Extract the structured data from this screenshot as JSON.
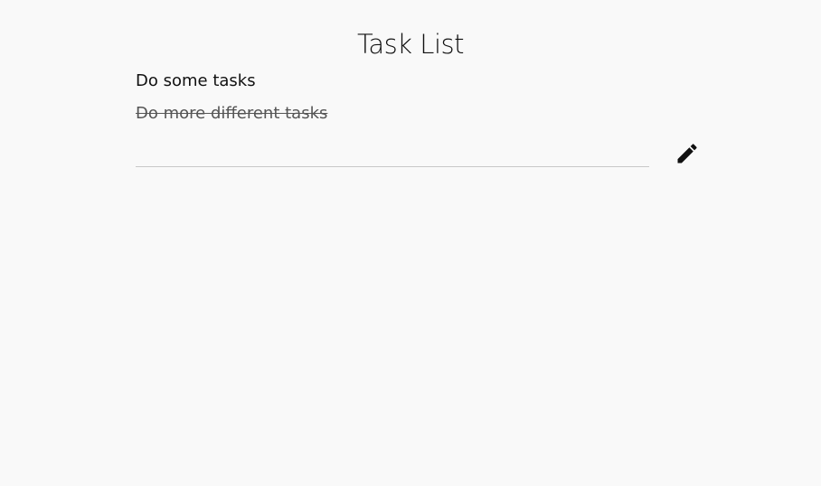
{
  "page": {
    "title": "Task List"
  },
  "tasks": [
    {
      "label": "Do some tasks",
      "done": false
    },
    {
      "label": "Do more different tasks",
      "done": true
    }
  ],
  "new_task": {
    "value": "",
    "placeholder": ""
  },
  "edit_button": {
    "icon": "pencil-icon"
  },
  "colors": {
    "background": "#f9f9f9",
    "text": "#111111",
    "completed_text": "#555555",
    "input_underline": "#c8c8c8"
  }
}
